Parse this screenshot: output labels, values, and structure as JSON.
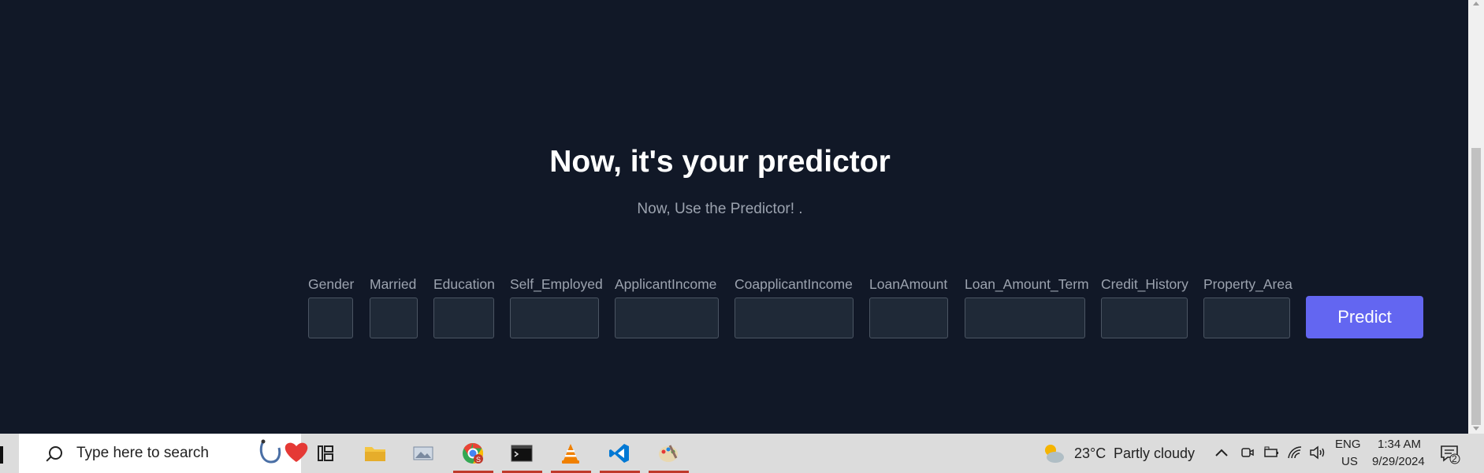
{
  "hero": {
    "title": "Now, it's your predictor",
    "subtitle": "Now, Use the Predictor! ."
  },
  "form": {
    "fields": [
      {
        "label": "Gender",
        "value": ""
      },
      {
        "label": "Married",
        "value": ""
      },
      {
        "label": "Education",
        "value": ""
      },
      {
        "label": "Self_Employed",
        "value": ""
      },
      {
        "label": "ApplicantIncome",
        "value": ""
      },
      {
        "label": "CoapplicantIncome",
        "value": ""
      },
      {
        "label": "LoanAmount",
        "value": ""
      },
      {
        "label": "Loan_Amount_Term",
        "value": ""
      },
      {
        "label": "Credit_History",
        "value": ""
      },
      {
        "label": "Property_Area",
        "value": ""
      }
    ],
    "submit_label": "Predict"
  },
  "taskbar": {
    "search_placeholder": "Type here to search",
    "apps": [
      "task-view-icon",
      "file-explorer-icon",
      "photos-icon",
      "chrome-icon",
      "terminal-icon",
      "vlc-icon",
      "vscode-icon",
      "paint-icon"
    ],
    "weather": {
      "temp": "23°C",
      "condition": "Partly cloudy"
    },
    "language": {
      "lang": "ENG",
      "region": "US"
    },
    "clock": {
      "time": "1:34 AM",
      "date": "9/29/2024"
    },
    "notification_count": "2"
  },
  "colors": {
    "background": "#111827",
    "accent": "#6366f1",
    "input_bg": "#1f2937",
    "label": "#9ca3af"
  }
}
